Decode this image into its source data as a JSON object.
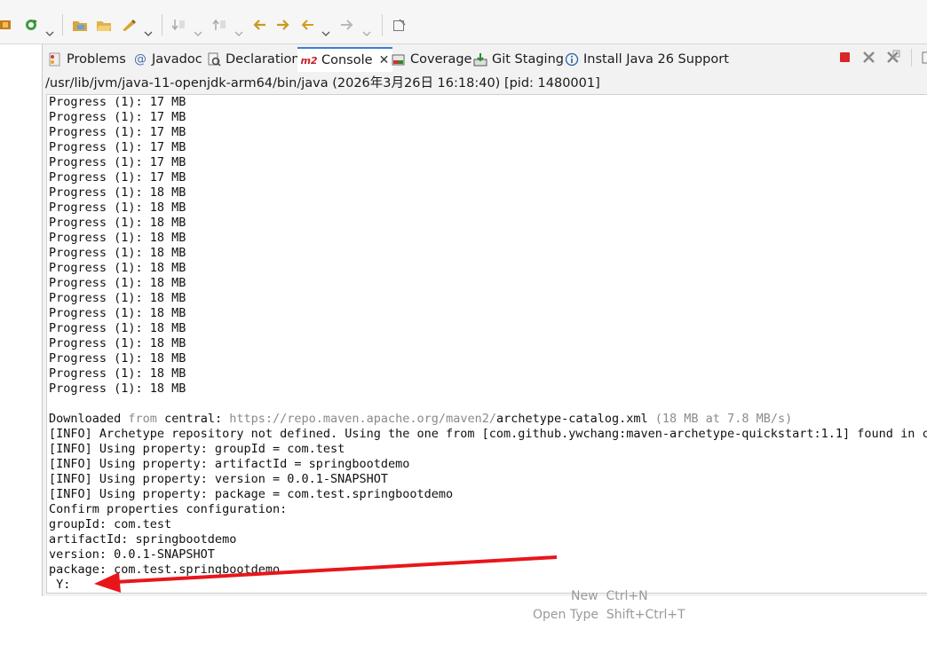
{
  "tabs": [
    {
      "label": "Problems",
      "icon": "problems-icon"
    },
    {
      "label": "Javadoc",
      "icon": "javadoc-icon"
    },
    {
      "label": "Declaration",
      "icon": "declaration-icon"
    },
    {
      "label": "Console",
      "icon": "console-icon",
      "active": true,
      "badge": "m2"
    },
    {
      "label": "Coverage",
      "icon": "coverage-icon"
    },
    {
      "label": "Git Staging",
      "icon": "git-staging-icon"
    },
    {
      "label": "Install Java 26 Support",
      "icon": "info-icon"
    }
  ],
  "process_path": "/usr/lib/jvm/java-11-openjdk-arm64/bin/java (2026年3月26日 16:18:40) [pid: 1480001]",
  "console": {
    "progress_lines": [
      "Progress (1): 17 MB",
      "Progress (1): 17 MB",
      "Progress (1): 17 MB",
      "Progress (1): 17 MB",
      "Progress (1): 17 MB",
      "Progress (1): 17 MB",
      "Progress (1): 18 MB",
      "Progress (1): 18 MB",
      "Progress (1): 18 MB",
      "Progress (1): 18 MB",
      "Progress (1): 18 MB",
      "Progress (1): 18 MB",
      "Progress (1): 18 MB",
      "Progress (1): 18 MB",
      "Progress (1): 18 MB",
      "Progress (1): 18 MB",
      "Progress (1): 18 MB",
      "Progress (1): 18 MB",
      "Progress (1): 18 MB",
      "Progress (1): 18 MB"
    ],
    "downloaded": {
      "word": "Downloaded",
      "from": " from ",
      "repo": "central",
      "colon": ": ",
      "url": "https://repo.maven.apache.org/maven2/",
      "file": "archetype-catalog.xml",
      "size": " (18 MB at 7.8 MB/s)"
    },
    "info_lines": [
      "[INFO] Archetype repository not defined. Using the one from [com.github.ywchang:maven-archetype-quickstart:1.1] found in cat",
      "[INFO] Using property: groupId = com.test",
      "[INFO] Using property: artifactId = springbootdemo",
      "[INFO] Using property: version = 0.0.1-SNAPSHOT",
      "[INFO] Using property: package = com.test.springbootdemo",
      "Confirm properties configuration:",
      "groupId: com.test",
      "artifactId: springbootdemo",
      "version: 0.0.1-SNAPSHOT",
      "package: com.test.springbootdemo"
    ],
    "prompt": " Y:"
  },
  "ghost_menu": {
    "new_label": "New",
    "new_shortcut": "Ctrl+N",
    "open_type_label": "Open Type",
    "open_type_shortcut": "Shift+Ctrl+T"
  },
  "colors": {
    "arrow": "#e8161b",
    "active_tab_accent": "#3b7ddd",
    "terminate_red": "#d9262b"
  }
}
